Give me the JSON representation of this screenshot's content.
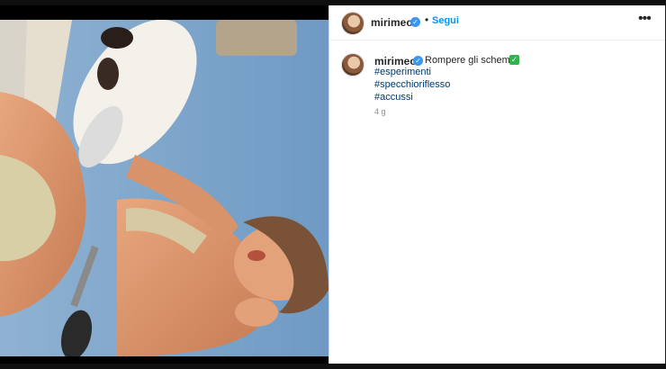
{
  "post": {
    "username": "mirimeo",
    "follow_label": "Segui",
    "separator": "•",
    "more_label": "•••",
    "caption_text": "Rompere gli schemi",
    "check_symbol": "✓",
    "hashtags": [
      "#esperimenti",
      "#specchioriflesso",
      "#accussi"
    ],
    "timestamp": "4 g"
  },
  "icons": {
    "verified": "verified-badge-icon",
    "check": "check-mark-icon",
    "more": "more-options-icon"
  },
  "colors": {
    "link": "#0095f6",
    "hashtag": "#00376b",
    "verified": "#3897f0",
    "check": "#2fb34a"
  }
}
